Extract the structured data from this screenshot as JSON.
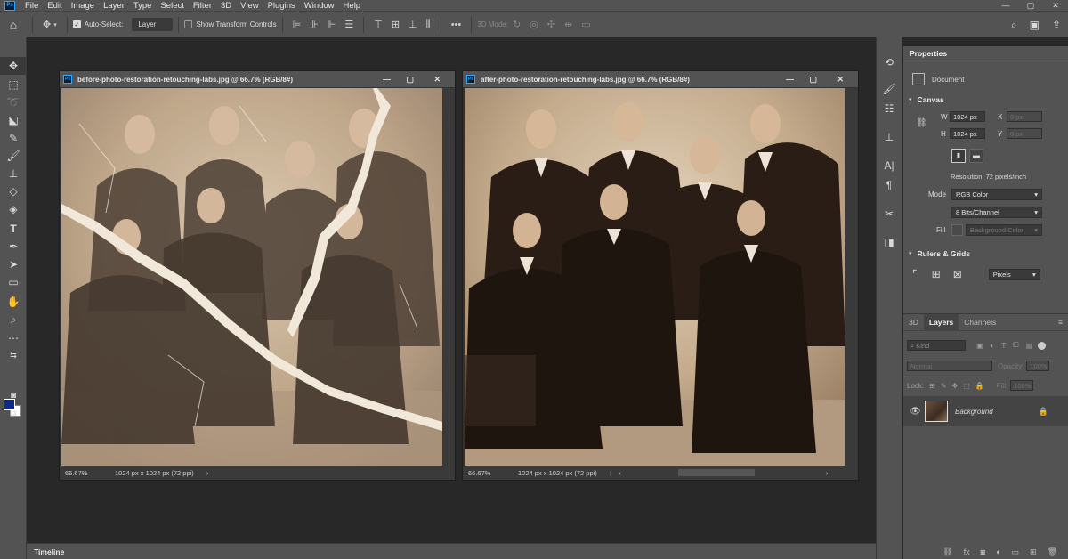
{
  "app": {
    "logo": "Ps"
  },
  "menu": [
    "File",
    "Edit",
    "Image",
    "Layer",
    "Type",
    "Select",
    "Filter",
    "3D",
    "View",
    "Plugins",
    "Window",
    "Help"
  ],
  "window_controls": {
    "minimize": "—",
    "restore": "▢",
    "close": "✕"
  },
  "options_bar": {
    "auto_select_label": "Auto-Select:",
    "auto_select_checked": true,
    "auto_select_target": "Layer",
    "transform_controls_label": "Show Transform Controls",
    "more": "•••",
    "mode_3d_label": "3D Mode:"
  },
  "tools": [
    "move-tool",
    "marquee-tool",
    "lasso-tool",
    "object-select-tool",
    "eyedropper-tool",
    "brush-tool",
    "stamp-tool",
    "eraser-tool",
    "paint-bucket-tool",
    "type-tool",
    "pen-tool",
    "path-select-tool",
    "rectangle-tool",
    "hand-tool",
    "zoom-tool",
    "more-tools"
  ],
  "colors": {
    "foreground": "#0e2b8a",
    "background": "#ffffff",
    "ps_blue": "#31a8ff"
  },
  "documents": [
    {
      "title": "before-photo-restoration-retouching-labs.jpg @ 66.7% (RGB/8#)",
      "zoom": "66.67%",
      "info": "1024 px x 1024 px (72 ppi)"
    },
    {
      "title": "after-photo-restoration-retouching-labs.jpg @ 66.7% (RGB/8#)",
      "zoom": "66.67%",
      "info": "1024 px x 1024 px (72 ppi)"
    }
  ],
  "properties": {
    "tab": "Properties",
    "type": "Document",
    "canvas_header": "Canvas",
    "w_label": "W",
    "w_value": "1024 px",
    "h_label": "H",
    "h_value": "1024 px",
    "x_label": "X",
    "x_value": "0 px",
    "y_label": "Y",
    "y_value": "0 px",
    "resolution": "Resolution: 72 pixels/inch",
    "mode_label": "Mode",
    "mode_value": "RGB Color",
    "depth_value": "8 Bits/Channel",
    "fill_label": "Fill",
    "fill_value": "Background Color",
    "rulers_header": "Rulers & Grids",
    "units_value": "Pixels"
  },
  "layers_panel": {
    "tabs": [
      "3D",
      "Layers",
      "Channels"
    ],
    "active_tab": "Layers",
    "kind_placeholder": "Kind",
    "blend_mode": "Normal",
    "opacity_label": "Opacity:",
    "opacity_value": "100%",
    "lock_label": "Lock:",
    "fill_label": "Fill:",
    "fill_value": "100%",
    "layer_name": "Background"
  },
  "timeline": {
    "label": "Timeline"
  }
}
